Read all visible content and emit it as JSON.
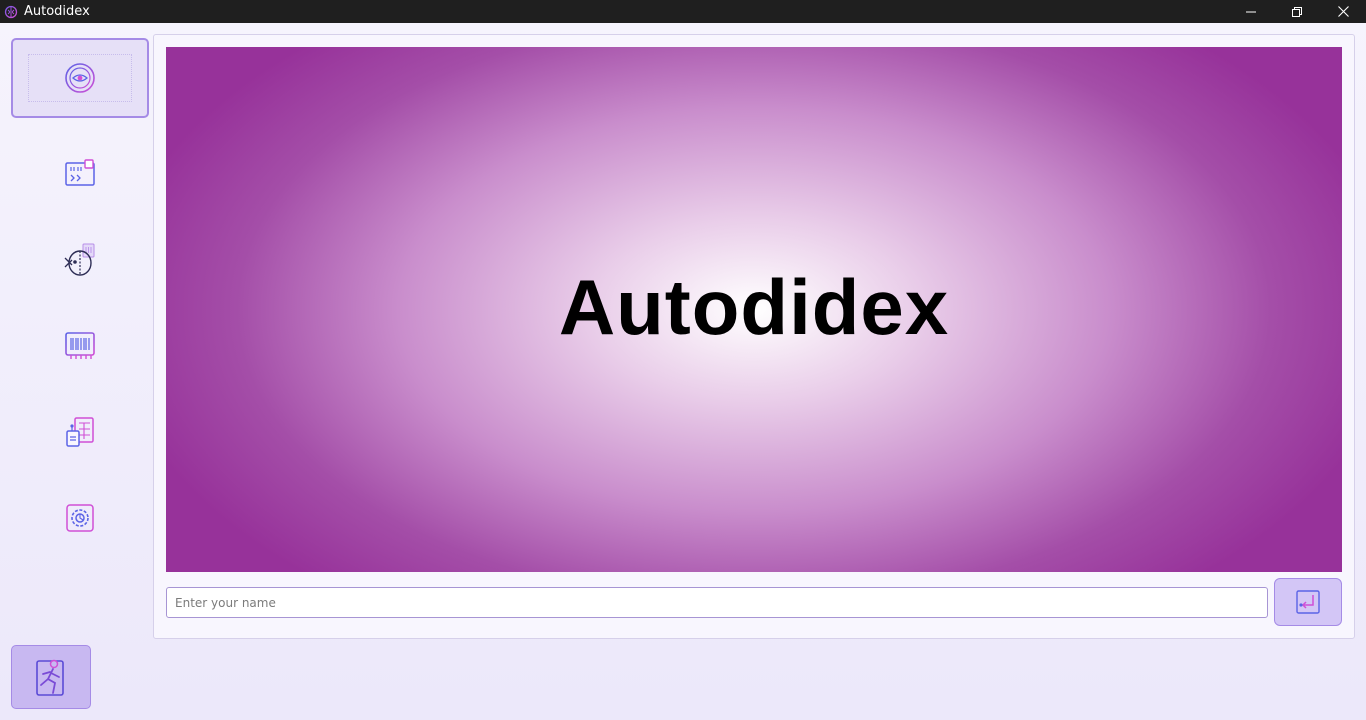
{
  "window": {
    "title": "Autodidex",
    "icon": "brain-icon",
    "controls": [
      "minimize-icon",
      "restore-icon",
      "close-icon"
    ]
  },
  "sidebar": {
    "items": [
      {
        "name": "home",
        "icon": "eye-orb-icon",
        "active": true
      },
      {
        "name": "code",
        "icon": "code-panel-icon",
        "active": false
      },
      {
        "name": "mind",
        "icon": "brain-profile-icon",
        "active": false
      },
      {
        "name": "data",
        "icon": "barcode-chip-icon",
        "active": false
      },
      {
        "name": "documents",
        "icon": "documents-grid-icon",
        "active": false
      },
      {
        "name": "settings",
        "icon": "gear-icon",
        "active": false
      }
    ],
    "exit": {
      "icon": "exit-run-icon"
    }
  },
  "main": {
    "banner": {
      "title": "Autodidex"
    },
    "name_input": {
      "placeholder": "Enter your name",
      "value": ""
    },
    "submit": {
      "icon": "enter-arrow-icon"
    }
  },
  "colors": {
    "accent": "#a58be6",
    "icon_primary": "#7a5ae8",
    "icon_secondary": "#d04fd6",
    "banner_edge": "#97329a",
    "banner_center": "#ffffff",
    "titlebar": "#1f1f1f"
  }
}
